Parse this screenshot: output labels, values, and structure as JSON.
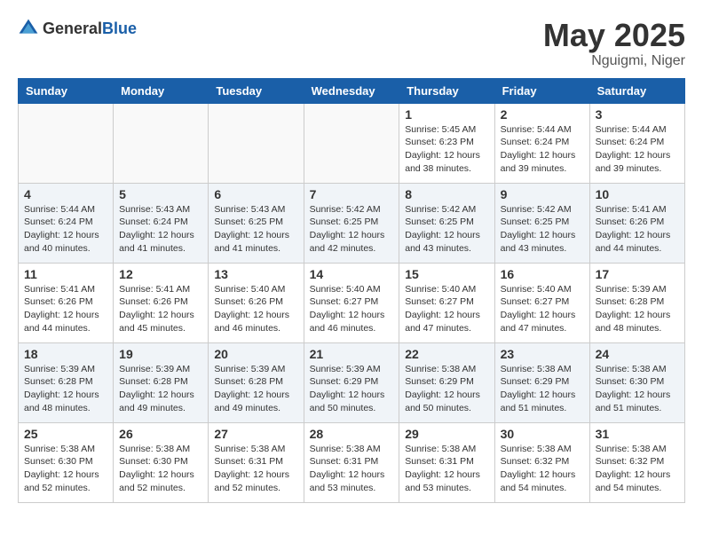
{
  "header": {
    "logo": {
      "general": "General",
      "blue": "Blue"
    },
    "title": "May 2025",
    "location": "Nguigmi, Niger"
  },
  "weekdays": [
    "Sunday",
    "Monday",
    "Tuesday",
    "Wednesday",
    "Thursday",
    "Friday",
    "Saturday"
  ],
  "weeks": [
    [
      {
        "day": "",
        "info": ""
      },
      {
        "day": "",
        "info": ""
      },
      {
        "day": "",
        "info": ""
      },
      {
        "day": "",
        "info": ""
      },
      {
        "day": "1",
        "info": "Sunrise: 5:45 AM\nSunset: 6:23 PM\nDaylight: 12 hours\nand 38 minutes."
      },
      {
        "day": "2",
        "info": "Sunrise: 5:44 AM\nSunset: 6:24 PM\nDaylight: 12 hours\nand 39 minutes."
      },
      {
        "day": "3",
        "info": "Sunrise: 5:44 AM\nSunset: 6:24 PM\nDaylight: 12 hours\nand 39 minutes."
      }
    ],
    [
      {
        "day": "4",
        "info": "Sunrise: 5:44 AM\nSunset: 6:24 PM\nDaylight: 12 hours\nand 40 minutes."
      },
      {
        "day": "5",
        "info": "Sunrise: 5:43 AM\nSunset: 6:24 PM\nDaylight: 12 hours\nand 41 minutes."
      },
      {
        "day": "6",
        "info": "Sunrise: 5:43 AM\nSunset: 6:25 PM\nDaylight: 12 hours\nand 41 minutes."
      },
      {
        "day": "7",
        "info": "Sunrise: 5:42 AM\nSunset: 6:25 PM\nDaylight: 12 hours\nand 42 minutes."
      },
      {
        "day": "8",
        "info": "Sunrise: 5:42 AM\nSunset: 6:25 PM\nDaylight: 12 hours\nand 43 minutes."
      },
      {
        "day": "9",
        "info": "Sunrise: 5:42 AM\nSunset: 6:25 PM\nDaylight: 12 hours\nand 43 minutes."
      },
      {
        "day": "10",
        "info": "Sunrise: 5:41 AM\nSunset: 6:26 PM\nDaylight: 12 hours\nand 44 minutes."
      }
    ],
    [
      {
        "day": "11",
        "info": "Sunrise: 5:41 AM\nSunset: 6:26 PM\nDaylight: 12 hours\nand 44 minutes."
      },
      {
        "day": "12",
        "info": "Sunrise: 5:41 AM\nSunset: 6:26 PM\nDaylight: 12 hours\nand 45 minutes."
      },
      {
        "day": "13",
        "info": "Sunrise: 5:40 AM\nSunset: 6:26 PM\nDaylight: 12 hours\nand 46 minutes."
      },
      {
        "day": "14",
        "info": "Sunrise: 5:40 AM\nSunset: 6:27 PM\nDaylight: 12 hours\nand 46 minutes."
      },
      {
        "day": "15",
        "info": "Sunrise: 5:40 AM\nSunset: 6:27 PM\nDaylight: 12 hours\nand 47 minutes."
      },
      {
        "day": "16",
        "info": "Sunrise: 5:40 AM\nSunset: 6:27 PM\nDaylight: 12 hours\nand 47 minutes."
      },
      {
        "day": "17",
        "info": "Sunrise: 5:39 AM\nSunset: 6:28 PM\nDaylight: 12 hours\nand 48 minutes."
      }
    ],
    [
      {
        "day": "18",
        "info": "Sunrise: 5:39 AM\nSunset: 6:28 PM\nDaylight: 12 hours\nand 48 minutes."
      },
      {
        "day": "19",
        "info": "Sunrise: 5:39 AM\nSunset: 6:28 PM\nDaylight: 12 hours\nand 49 minutes."
      },
      {
        "day": "20",
        "info": "Sunrise: 5:39 AM\nSunset: 6:28 PM\nDaylight: 12 hours\nand 49 minutes."
      },
      {
        "day": "21",
        "info": "Sunrise: 5:39 AM\nSunset: 6:29 PM\nDaylight: 12 hours\nand 50 minutes."
      },
      {
        "day": "22",
        "info": "Sunrise: 5:38 AM\nSunset: 6:29 PM\nDaylight: 12 hours\nand 50 minutes."
      },
      {
        "day": "23",
        "info": "Sunrise: 5:38 AM\nSunset: 6:29 PM\nDaylight: 12 hours\nand 51 minutes."
      },
      {
        "day": "24",
        "info": "Sunrise: 5:38 AM\nSunset: 6:30 PM\nDaylight: 12 hours\nand 51 minutes."
      }
    ],
    [
      {
        "day": "25",
        "info": "Sunrise: 5:38 AM\nSunset: 6:30 PM\nDaylight: 12 hours\nand 52 minutes."
      },
      {
        "day": "26",
        "info": "Sunrise: 5:38 AM\nSunset: 6:30 PM\nDaylight: 12 hours\nand 52 minutes."
      },
      {
        "day": "27",
        "info": "Sunrise: 5:38 AM\nSunset: 6:31 PM\nDaylight: 12 hours\nand 52 minutes."
      },
      {
        "day": "28",
        "info": "Sunrise: 5:38 AM\nSunset: 6:31 PM\nDaylight: 12 hours\nand 53 minutes."
      },
      {
        "day": "29",
        "info": "Sunrise: 5:38 AM\nSunset: 6:31 PM\nDaylight: 12 hours\nand 53 minutes."
      },
      {
        "day": "30",
        "info": "Sunrise: 5:38 AM\nSunset: 6:32 PM\nDaylight: 12 hours\nand 54 minutes."
      },
      {
        "day": "31",
        "info": "Sunrise: 5:38 AM\nSunset: 6:32 PM\nDaylight: 12 hours\nand 54 minutes."
      }
    ]
  ]
}
